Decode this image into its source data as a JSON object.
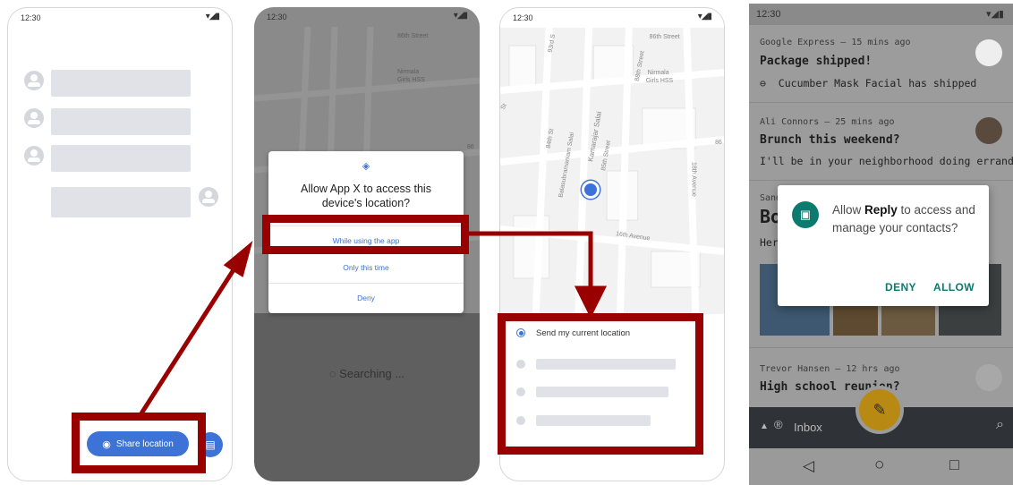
{
  "phone1": {
    "time": "12:30",
    "status_icons": "▾◢▮",
    "share_label": "Share location",
    "share_icon": "location-pin-icon",
    "chat_icon": "message-icon"
  },
  "phone2": {
    "time": "12:30",
    "status_icons": "▾◢▮",
    "dialog": {
      "title": "Allow App X to access this device's location?",
      "options": [
        "While using the app",
        "Only this time",
        "Deny"
      ]
    },
    "searching": "Searching ..."
  },
  "phone3": {
    "time": "12:30",
    "status_icons": "▾◢▮",
    "send_location": "Send my current location"
  },
  "map_labels": {
    "street_86": "86th Street",
    "girls_hss_1": "Nirmala",
    "girls_hss_2": "Girls HSS",
    "salai_88": "88th Street",
    "st_93": "93rd S",
    "st_84": "84th St",
    "kamarajar": "Kamarajar Salai",
    "balasubramaniam": "Balasubramaniam Salai",
    "st_85": "85th Street",
    "avenue_18": "18th Avenue",
    "avenue_16": "16th Avenue",
    "num_86": "86",
    "st_short": "St"
  },
  "phone4": {
    "time": "12:30",
    "status_icons": "▾◢▮",
    "cards": [
      {
        "meta": "Google Express — 15 mins ago",
        "subject": "Package shipped!",
        "preview": "Cucumber Mask Facial has shipped"
      },
      {
        "meta": "Ali Connors — 25 mins ago",
        "subject": "Brunch this weekend?",
        "preview": "I'll be in your neighborhood doing errands..."
      },
      {
        "meta": "Sand",
        "subject": "Bo",
        "preview": "Her"
      },
      {
        "meta": "Trevor Hansen — 12 hrs ago",
        "subject": "High school reunion?",
        "preview": ""
      }
    ],
    "permission": {
      "prefix": "Allow ",
      "app": "Reply",
      "suffix": " to access and manage your contacts?",
      "deny": "DENY",
      "allow": "ALLOW"
    },
    "inbox_label": "Inbox",
    "nav": {
      "back": "◁",
      "home": "○",
      "recents": "□"
    }
  },
  "colors": {
    "accent_blue": "#3d72d6",
    "annotation_red": "#990000",
    "teal": "#0d7a6f",
    "fab": "#b88a14"
  }
}
